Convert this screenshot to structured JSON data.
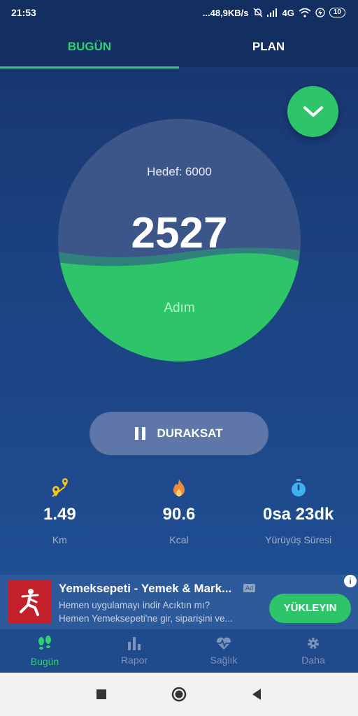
{
  "status_bar": {
    "time": "21:53",
    "net_speed": "...48,9KB/s",
    "network": "4G",
    "battery": "10"
  },
  "tabs": [
    {
      "label": "BUGÜN",
      "active": true
    },
    {
      "label": "PLAN",
      "active": false
    }
  ],
  "progress": {
    "goal_text": "Hedef: 6000",
    "steps": "2527",
    "steps_label": "Adım",
    "fill_fraction": 0.42
  },
  "pause_button": {
    "label": "DURAKSAT"
  },
  "stats": [
    {
      "value": "1.49",
      "label": "Km",
      "icon": "map-pin-route-icon"
    },
    {
      "value": "90.6",
      "label": "Kcal",
      "icon": "flame-icon"
    },
    {
      "value": "0sa 23dk",
      "label": "Yürüyüş Süresi",
      "icon": "stopwatch-icon"
    }
  ],
  "ad": {
    "title": "Yemeksepeti - Yemek & Mark...",
    "badge": "Ad",
    "desc_line1": "Hemen uygulamayı indir Acıktın mı?",
    "desc_line2": "Hemen Yemeksepeti'ne gir, siparişini ve...",
    "cta": "YÜKLEYIN"
  },
  "bottom_nav": [
    {
      "label": "Bugün",
      "icon": "footsteps-icon",
      "active": true
    },
    {
      "label": "Rapor",
      "icon": "bar-chart-icon",
      "active": false
    },
    {
      "label": "Sağlık",
      "icon": "heart-pulse-icon",
      "active": false
    },
    {
      "label": "Daha",
      "icon": "gear-icon",
      "active": false
    }
  ],
  "colors": {
    "accent": "#2ec46a",
    "background": "#1b3f7d"
  }
}
